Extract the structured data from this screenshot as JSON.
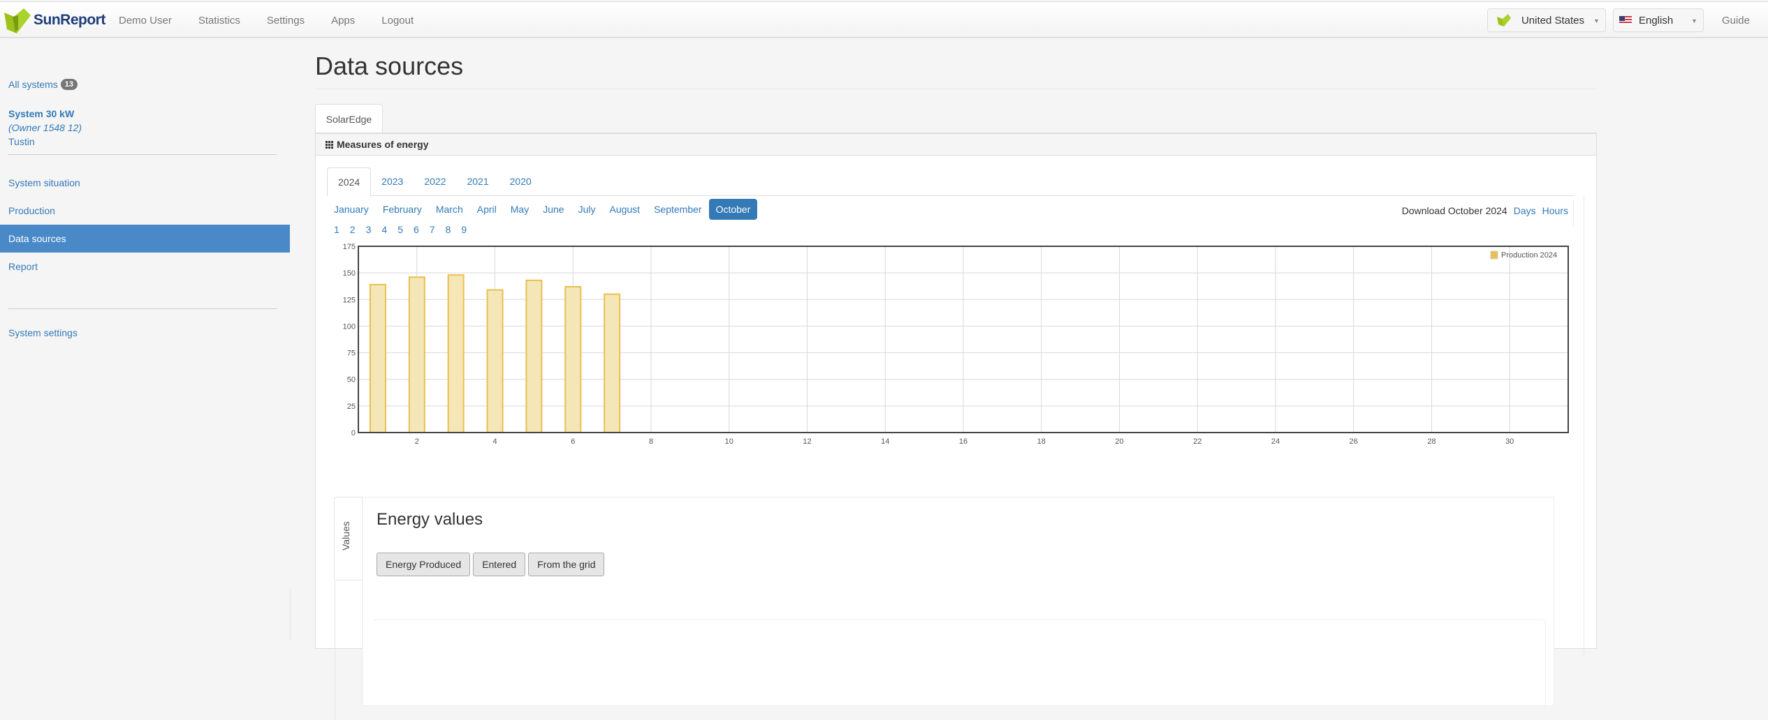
{
  "navbar": {
    "brand": "SunReport",
    "links": [
      "Demo User",
      "Statistics",
      "Settings",
      "Apps",
      "Logout"
    ],
    "country_select": "United States",
    "language_select": "English",
    "guide": "Guide"
  },
  "sidebar": {
    "all_systems_label": "All systems",
    "all_systems_count": "13",
    "system_name": "System 30 kW",
    "system_owner": "(Owner 1548 12)",
    "system_city": "Tustin",
    "items": [
      {
        "label": "System situation",
        "active": false
      },
      {
        "label": "Production",
        "active": false
      },
      {
        "label": "Data sources",
        "active": true
      },
      {
        "label": "Report",
        "active": false
      }
    ],
    "settings_label": "System settings"
  },
  "main": {
    "title": "Data sources",
    "source_tab": "SolarEdge",
    "panel_title": "Measures of energy",
    "year_tabs": [
      {
        "label": "2024",
        "active": true
      },
      {
        "label": "2023",
        "active": false
      },
      {
        "label": "2022",
        "active": false
      },
      {
        "label": "2021",
        "active": false
      },
      {
        "label": "2020",
        "active": false
      }
    ],
    "months": [
      {
        "label": "January",
        "active": false
      },
      {
        "label": "February",
        "active": false
      },
      {
        "label": "March",
        "active": false
      },
      {
        "label": "April",
        "active": false
      },
      {
        "label": "May",
        "active": false
      },
      {
        "label": "June",
        "active": false
      },
      {
        "label": "July",
        "active": false
      },
      {
        "label": "August",
        "active": false
      },
      {
        "label": "September",
        "active": false
      },
      {
        "label": "October",
        "active": true
      }
    ],
    "days": [
      "1",
      "2",
      "3",
      "4",
      "5",
      "6",
      "7",
      "8",
      "9"
    ],
    "download_label": "Download October 2024",
    "download_days": "Days",
    "download_hours": "Hours",
    "energy_values": {
      "side_tab": "Values",
      "title": "Energy values",
      "buttons": [
        "Energy Produced",
        "Entered",
        "From the grid"
      ]
    }
  },
  "colors": {
    "accent": "#337ab7",
    "sidebar_active": "#4a89c8",
    "bar_fill": "#f5e6b8",
    "bar_stroke": "#e8c04e"
  },
  "chart_data": {
    "type": "bar",
    "title": "",
    "xlabel": "",
    "ylabel": "",
    "x": [
      1,
      2,
      3,
      4,
      5,
      6,
      7
    ],
    "series": [
      {
        "name": "Production 2024",
        "values": [
          139,
          146,
          148,
          134,
          143,
          137,
          130
        ]
      }
    ],
    "xlim": [
      0.5,
      31.5
    ],
    "ylim": [
      0,
      175
    ],
    "xticks": [
      2,
      4,
      6,
      8,
      10,
      12,
      14,
      16,
      18,
      20,
      22,
      24,
      26,
      28,
      30
    ],
    "yticks": [
      0,
      25,
      50,
      75,
      100,
      125,
      150,
      175
    ],
    "grid": true,
    "legend": "top-right"
  }
}
